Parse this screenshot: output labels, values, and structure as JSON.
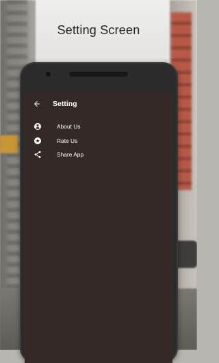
{
  "headline": "Setting Screen",
  "toolbar": {
    "title": "Setting",
    "back_icon": "arrow-left-icon"
  },
  "menu": [
    {
      "label": "About Us",
      "icon": "account-circle-icon"
    },
    {
      "label": "Rate Us",
      "icon": "star-circle-icon"
    },
    {
      "label": "Share App",
      "icon": "share-icon"
    }
  ],
  "colors": {
    "screen_bg": "#332a27",
    "text": "#ffffff",
    "headline": "#222222"
  }
}
